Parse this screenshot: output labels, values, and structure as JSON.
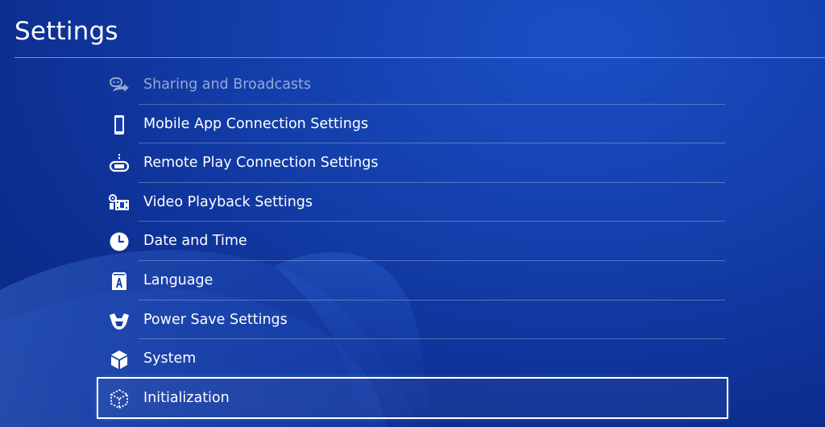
{
  "header": {
    "title": "Settings"
  },
  "settings": {
    "items": [
      {
        "label": "Sharing and Broadcasts",
        "icon": "share-broadcast-icon",
        "state": "faded"
      },
      {
        "label": "Mobile App Connection Settings",
        "icon": "smartphone-icon",
        "state": "normal"
      },
      {
        "label": "Remote Play Connection Settings",
        "icon": "remote-play-icon",
        "state": "normal"
      },
      {
        "label": "Video Playback Settings",
        "icon": "video-playback-icon",
        "state": "normal"
      },
      {
        "label": "Date and Time",
        "icon": "clock-icon",
        "state": "normal"
      },
      {
        "label": "Language",
        "icon": "language-icon",
        "state": "normal"
      },
      {
        "label": "Power Save Settings",
        "icon": "power-save-icon",
        "state": "normal"
      },
      {
        "label": "System",
        "icon": "system-cube-icon",
        "state": "normal"
      },
      {
        "label": "Initialization",
        "icon": "initialization-cube-icon",
        "state": "selected"
      }
    ]
  },
  "colors": {
    "background": "#1440ad",
    "text": "#ffffff",
    "selection_border": "#ffffff"
  }
}
